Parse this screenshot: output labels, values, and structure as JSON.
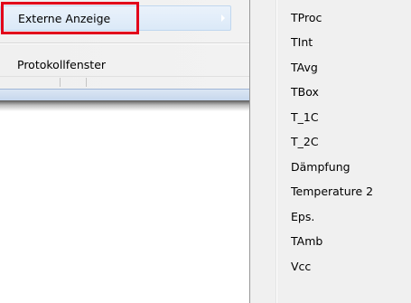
{
  "main_menu": {
    "items": [
      {
        "label": "Externe Anzeige",
        "has_submenu": true
      },
      {
        "label": "Protokollfenster",
        "has_submenu": false
      }
    ]
  },
  "submenu": {
    "items": [
      {
        "label": "TProc"
      },
      {
        "label": "TInt"
      },
      {
        "label": "TAvg"
      },
      {
        "label": "TBox"
      },
      {
        "label": "T_1C"
      },
      {
        "label": "T_2C"
      },
      {
        "label": "Dämpfung"
      },
      {
        "label": "Temperature 2"
      },
      {
        "label": "Eps."
      },
      {
        "label": "TAmb"
      },
      {
        "label": "Vcc"
      }
    ]
  },
  "colors": {
    "highlight_border": "#e2001a",
    "menu_background": "#f0f0f0",
    "hover_background": "#dbe9f8"
  }
}
